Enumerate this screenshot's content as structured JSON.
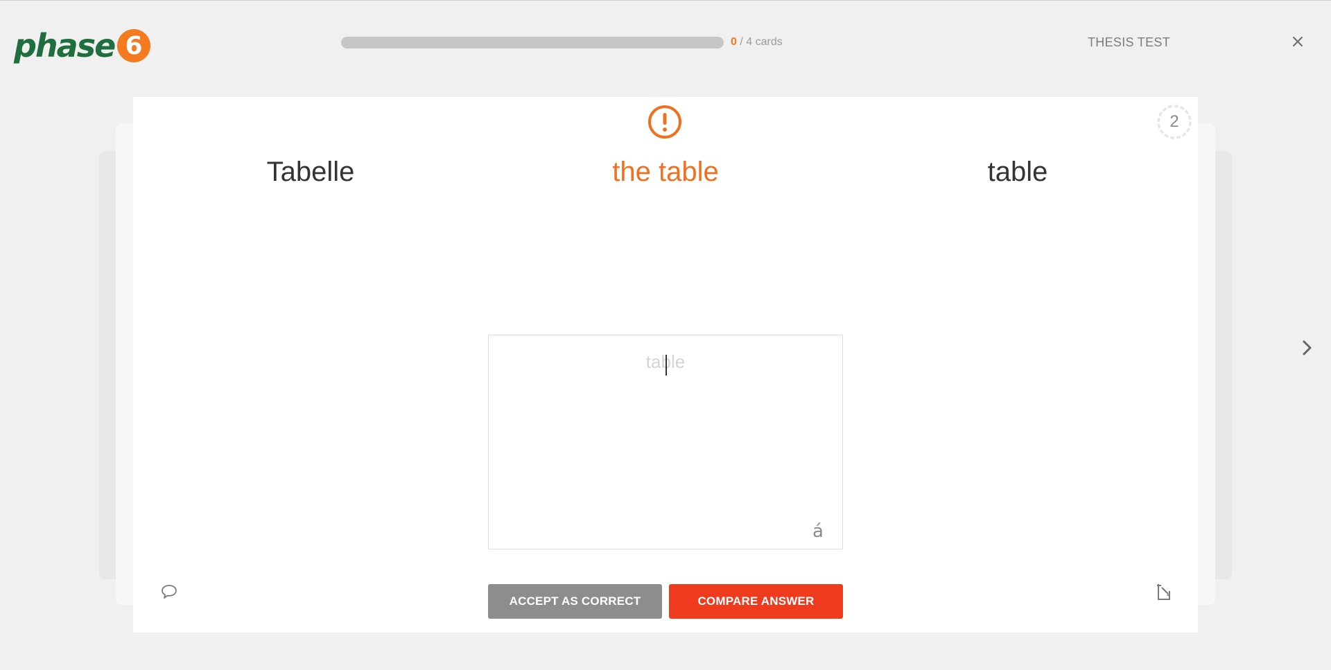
{
  "header": {
    "logo": {
      "text": "phase",
      "digit": "6"
    },
    "progress": {
      "current": "0",
      "separator": " / ",
      "total_label": "4 cards",
      "fraction": 0
    },
    "deck_title": "THESIS TEST",
    "close_icon": "close-icon"
  },
  "card": {
    "status_icon": "exclamation-circle-icon",
    "phase": "2",
    "words": {
      "source": "Tabelle",
      "translation": "the table",
      "hint": "table"
    },
    "answer": {
      "value": "",
      "placeholder": "table",
      "accent_key": "á"
    },
    "buttons": {
      "accept": "ACCEPT AS CORRECT",
      "compare": "COMPARE ANSWER"
    },
    "comment_icon": "speech-bubble-icon",
    "edit_icon": "edit-card-icon"
  },
  "navigation": {
    "next_icon": "chevron-right-icon"
  },
  "colors": {
    "brand_green": "#1f6e3f",
    "brand_orange": "#f47a1f",
    "compare_red": "#ee3a1d",
    "accept_gray": "#8d8d8d"
  }
}
